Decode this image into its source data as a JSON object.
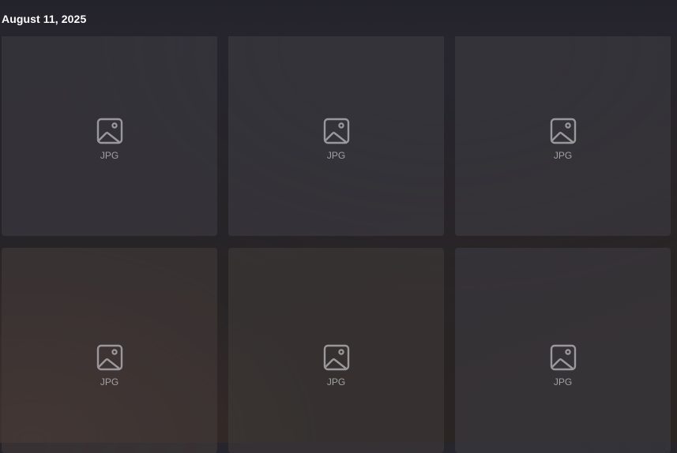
{
  "section": {
    "date_label": "August 11, 2025"
  },
  "tiles": [
    {
      "file_type": "JPG",
      "icon": "image-icon"
    },
    {
      "file_type": "JPG",
      "icon": "image-icon"
    },
    {
      "file_type": "JPG",
      "icon": "image-icon"
    },
    {
      "file_type": "JPG",
      "icon": "image-icon"
    },
    {
      "file_type": "JPG",
      "icon": "image-icon"
    },
    {
      "file_type": "JPG",
      "icon": "image-icon"
    }
  ],
  "colors": {
    "header_text": "#ffffff",
    "placeholder_icon": "#9a989c",
    "placeholder_text": "#a2a0a4"
  }
}
